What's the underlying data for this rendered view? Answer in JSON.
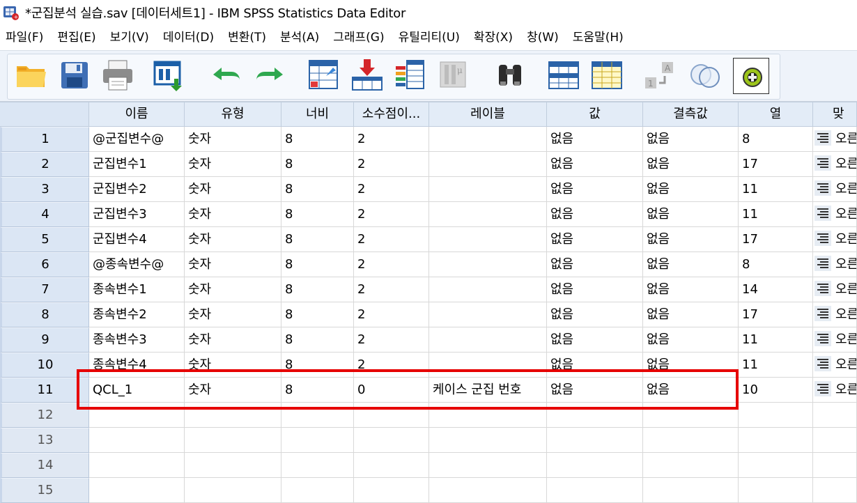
{
  "window": {
    "title": "*군집분석 실습.sav [데이터세트1] - IBM SPSS Statistics Data Editor",
    "app_icon": "spss-data-editor-icon"
  },
  "menu": [
    "파일(F)",
    "편집(E)",
    "보기(V)",
    "데이터(D)",
    "변환(T)",
    "분석(A)",
    "그래프(G)",
    "유틸리티(U)",
    "확장(X)",
    "창(W)",
    "도움말(H)"
  ],
  "toolbar": {
    "buttons": [
      "open-folder-icon",
      "save-disk-icon",
      "print-icon",
      "dialog-recall-icon",
      "undo-icon",
      "redo-icon",
      "goto-case-icon",
      "goto-variable-icon",
      "variables-icon",
      "run-descriptives-icon",
      "find-binoculars-icon",
      "insert-cases-icon",
      "insert-variable-icon",
      "split-file-icon",
      "value-labels-icon",
      "use-sets-icon"
    ]
  },
  "grid": {
    "columns": [
      "이름",
      "유형",
      "너비",
      "소수점이...",
      "레이블",
      "값",
      "결측값",
      "열",
      "맞"
    ],
    "rows": [
      {
        "n": "1",
        "name": "@군집변수@",
        "type": "숫자",
        "width": "8",
        "decimals": "2",
        "label": "",
        "values": "없음",
        "missing": "없음",
        "columns": "8",
        "align": "오른"
      },
      {
        "n": "2",
        "name": "군집변수1",
        "type": "숫자",
        "width": "8",
        "decimals": "2",
        "label": "",
        "values": "없음",
        "missing": "없음",
        "columns": "17",
        "align": "오른"
      },
      {
        "n": "3",
        "name": "군집변수2",
        "type": "숫자",
        "width": "8",
        "decimals": "2",
        "label": "",
        "values": "없음",
        "missing": "없음",
        "columns": "11",
        "align": "오른"
      },
      {
        "n": "4",
        "name": "군집변수3",
        "type": "숫자",
        "width": "8",
        "decimals": "2",
        "label": "",
        "values": "없음",
        "missing": "없음",
        "columns": "11",
        "align": "오른"
      },
      {
        "n": "5",
        "name": "군집변수4",
        "type": "숫자",
        "width": "8",
        "decimals": "2",
        "label": "",
        "values": "없음",
        "missing": "없음",
        "columns": "17",
        "align": "오른"
      },
      {
        "n": "6",
        "name": "@종속변수@",
        "type": "숫자",
        "width": "8",
        "decimals": "2",
        "label": "",
        "values": "없음",
        "missing": "없음",
        "columns": "8",
        "align": "오른"
      },
      {
        "n": "7",
        "name": "종속변수1",
        "type": "숫자",
        "width": "8",
        "decimals": "2",
        "label": "",
        "values": "없음",
        "missing": "없음",
        "columns": "14",
        "align": "오른"
      },
      {
        "n": "8",
        "name": "종속변수2",
        "type": "숫자",
        "width": "8",
        "decimals": "2",
        "label": "",
        "values": "없음",
        "missing": "없음",
        "columns": "17",
        "align": "오른"
      },
      {
        "n": "9",
        "name": "종속변수3",
        "type": "숫자",
        "width": "8",
        "decimals": "2",
        "label": "",
        "values": "없음",
        "missing": "없음",
        "columns": "11",
        "align": "오른"
      },
      {
        "n": "10",
        "name": "종속변수4",
        "type": "숫자",
        "width": "8",
        "decimals": "2",
        "label": "",
        "values": "없음",
        "missing": "없음",
        "columns": "11",
        "align": "오른"
      },
      {
        "n": "11",
        "name": "QCL_1",
        "type": "숫자",
        "width": "8",
        "decimals": "0",
        "label": "케이스 군집 번호",
        "values": "없음",
        "missing": "없음",
        "columns": "10",
        "align": "오른"
      }
    ],
    "empty_rows": [
      "12",
      "13",
      "14",
      "15"
    ]
  },
  "highlight_color": "#e60000"
}
